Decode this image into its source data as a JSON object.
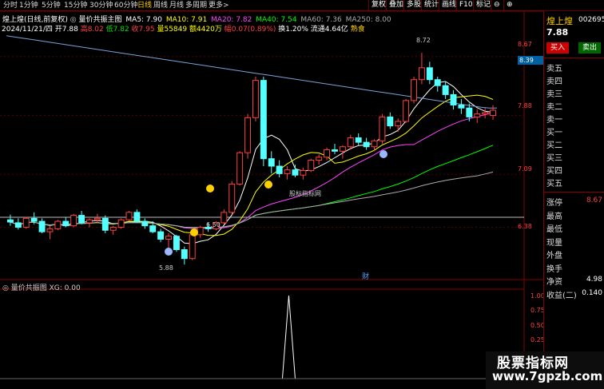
{
  "toolbar": {
    "periods": [
      "分时",
      "1分钟",
      "5分钟",
      "15分钟",
      "30分钟",
      "60分钟",
      "日线",
      "周线",
      "月线",
      "多周期",
      "更多>"
    ],
    "active_period": "日线",
    "buttons": [
      "复权",
      "叠加",
      "多股",
      "统计",
      "画线",
      "F10",
      "标记",
      "⊖",
      "⊕"
    ]
  },
  "main_header": {
    "title": "煌上煌(日线,前复权)",
    "indicator": "量价共振主图",
    "ma": [
      {
        "label": "MA5: 7.90",
        "color": "#ffffff"
      },
      {
        "label": "MA10: 7.91",
        "color": "#ffff00"
      },
      {
        "label": "MA20: 7.82",
        "color": "#ff44ff"
      },
      {
        "label": "MA40: 7.54",
        "color": "#00ff00"
      },
      {
        "label": "MA60: 7.36",
        "color": "#aaaaaa"
      },
      {
        "label": "MA250: 8.00",
        "color": "#aaaaaa"
      }
    ],
    "date": "2024/11/21/四",
    "open": "开7.88",
    "high": "高8.02",
    "low": "低7.82",
    "close": "收7.95",
    "volume": "量55849",
    "amount": "额4420万",
    "change": "幅0.07(0.89%)",
    "turnover": "换1.20%",
    "float_value": "流通4.64亿",
    "sector": "熟食"
  },
  "price_axis": {
    "labels": [
      "8.67",
      "7.88",
      "7.09",
      "6.38"
    ],
    "current_tag": "8.39"
  },
  "annotations": {
    "high_label": "8.72",
    "low_label": "5.88",
    "mid_label": "6.50",
    "watermark_text": "股标指标网",
    "fin_marker": "财"
  },
  "sub_chart": {
    "title": "量价共振图 XG: 0.00",
    "axis": [
      "1.00",
      "0.75",
      "0.50",
      "0.25"
    ]
  },
  "chart_data": {
    "type": "candlestick",
    "ylim": [
      5.7,
      9.0
    ],
    "series": [
      {
        "name": "MA5",
        "color": "#ffffff"
      },
      {
        "name": "MA10",
        "color": "#ffff00"
      },
      {
        "name": "MA20",
        "color": "#ff44ff"
      },
      {
        "name": "MA40",
        "color": "#00ff00"
      },
      {
        "name": "MA60",
        "color": "#aaaaaa"
      },
      {
        "name": "MA250",
        "color": "#aaaaaa"
      }
    ],
    "candles": [
      [
        6.48,
        6.55,
        6.4,
        6.45
      ],
      [
        6.44,
        6.5,
        6.35,
        6.38
      ],
      [
        6.38,
        6.52,
        6.36,
        6.5
      ],
      [
        6.5,
        6.58,
        6.42,
        6.46
      ],
      [
        6.46,
        6.5,
        6.3,
        6.32
      ],
      [
        6.32,
        6.4,
        6.22,
        6.36
      ],
      [
        6.36,
        6.48,
        6.34,
        6.46
      ],
      [
        6.46,
        6.52,
        6.38,
        6.4
      ],
      [
        6.4,
        6.56,
        6.38,
        6.54
      ],
      [
        6.54,
        6.6,
        6.42,
        6.44
      ],
      [
        6.44,
        6.5,
        6.38,
        6.48
      ],
      [
        6.48,
        6.56,
        6.44,
        6.5
      ],
      [
        6.5,
        6.54,
        6.3,
        6.34
      ],
      [
        6.34,
        6.4,
        6.28,
        6.38
      ],
      [
        6.38,
        6.5,
        6.36,
        6.48
      ],
      [
        6.48,
        6.6,
        6.46,
        6.58
      ],
      [
        6.58,
        6.62,
        6.44,
        6.46
      ],
      [
        6.46,
        6.5,
        6.36,
        6.4
      ],
      [
        6.4,
        6.46,
        6.3,
        6.32
      ],
      [
        6.32,
        6.36,
        6.18,
        6.22
      ],
      [
        6.22,
        6.3,
        6.1,
        6.26
      ],
      [
        6.26,
        6.28,
        6.05,
        6.08
      ],
      [
        6.08,
        6.12,
        5.88,
        5.96
      ],
      [
        5.96,
        6.3,
        5.94,
        6.28
      ],
      [
        6.28,
        6.4,
        6.24,
        6.38
      ],
      [
        6.38,
        6.44,
        6.32,
        6.36
      ],
      [
        6.36,
        6.46,
        6.34,
        6.44
      ],
      [
        6.44,
        6.62,
        6.42,
        6.58
      ],
      [
        6.58,
        7.0,
        6.55,
        6.96
      ],
      [
        6.96,
        7.4,
        6.94,
        7.38
      ],
      [
        7.38,
        7.9,
        7.3,
        7.85
      ],
      [
        7.85,
        8.4,
        7.8,
        8.35
      ],
      [
        8.35,
        8.4,
        7.2,
        7.3
      ],
      [
        7.3,
        7.4,
        7.1,
        7.2
      ],
      [
        7.2,
        7.28,
        7.05,
        7.1
      ],
      [
        7.1,
        7.2,
        7.02,
        7.15
      ],
      [
        7.15,
        7.22,
        7.05,
        7.08
      ],
      [
        7.08,
        7.18,
        7.02,
        7.14
      ],
      [
        7.14,
        7.3,
        7.12,
        7.28
      ],
      [
        7.28,
        7.36,
        7.22,
        7.32
      ],
      [
        7.32,
        7.45,
        7.28,
        7.42
      ],
      [
        7.42,
        7.5,
        7.36,
        7.4
      ],
      [
        7.4,
        7.48,
        7.3,
        7.46
      ],
      [
        7.46,
        7.62,
        7.42,
        7.58
      ],
      [
        7.58,
        7.64,
        7.48,
        7.52
      ],
      [
        7.52,
        7.58,
        7.42,
        7.46
      ],
      [
        7.46,
        7.56,
        7.4,
        7.54
      ],
      [
        7.54,
        7.9,
        7.5,
        7.86
      ],
      [
        7.86,
        7.92,
        7.7,
        7.74
      ],
      [
        7.74,
        7.84,
        7.66,
        7.8
      ],
      [
        7.8,
        8.1,
        7.78,
        8.08
      ],
      [
        8.08,
        8.4,
        8.04,
        8.36
      ],
      [
        8.36,
        8.72,
        8.3,
        8.52
      ],
      [
        8.52,
        8.6,
        8.3,
        8.36
      ],
      [
        8.36,
        8.4,
        8.2,
        8.28
      ],
      [
        8.28,
        8.34,
        8.1,
        8.16
      ],
      [
        8.16,
        8.22,
        7.96,
        8.02
      ],
      [
        8.02,
        8.1,
        7.9,
        7.98
      ],
      [
        7.98,
        8.04,
        7.8,
        7.86
      ],
      [
        7.86,
        7.96,
        7.78,
        7.9
      ],
      [
        7.9,
        7.98,
        7.84,
        7.92
      ],
      [
        7.88,
        8.02,
        7.82,
        7.95
      ]
    ],
    "spike_index": 36
  },
  "right_panel": {
    "name": "煌上煌",
    "code": "002695",
    "price": "7.88",
    "buy": "买入",
    "sell": "卖出",
    "book": [
      "卖五",
      "卖四",
      "卖三",
      "卖二",
      "卖一",
      "买一",
      "买二",
      "买三",
      "买四",
      "买五"
    ],
    "stats": [
      {
        "label": "涨停",
        "value": "8.67",
        "color": "#ff4040"
      },
      {
        "label": "最高",
        "value": "",
        "color": "#fff"
      },
      {
        "label": "最低",
        "value": "",
        "color": "#fff"
      },
      {
        "label": "现量",
        "value": "",
        "color": "#fff"
      },
      {
        "label": "外盘",
        "value": "",
        "color": "#fff"
      },
      {
        "label": "换手",
        "value": "",
        "color": "#fff"
      },
      {
        "label": "净资",
        "value": "4.98",
        "color": "#fff"
      },
      {
        "label": "收益(二)",
        "value": "0.140",
        "color": "#fff"
      }
    ]
  },
  "watermark": {
    "line1": "股票指标网",
    "line2": "www.7gpzb.com"
  }
}
